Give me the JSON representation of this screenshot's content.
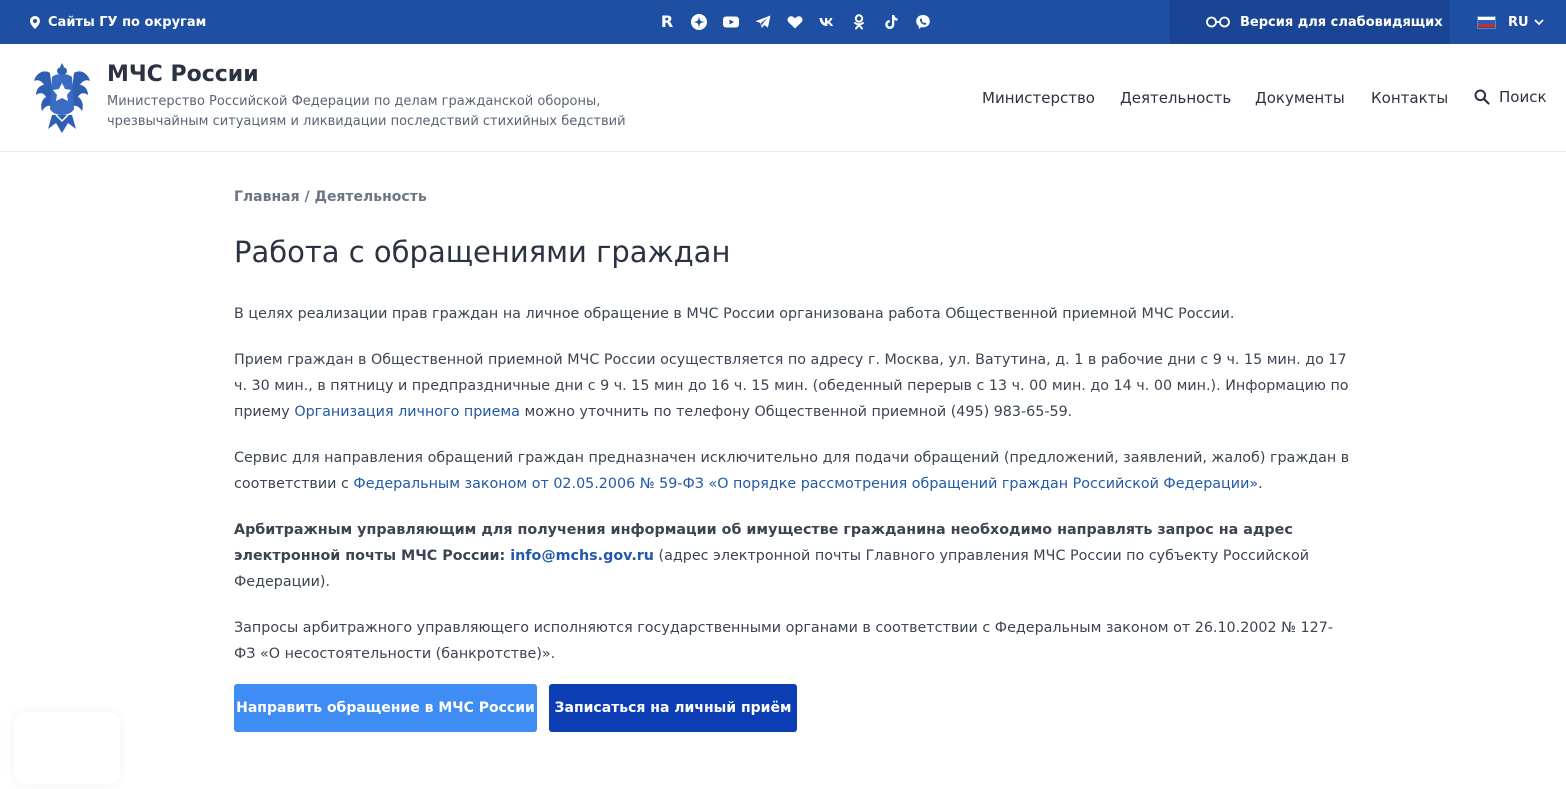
{
  "topbar": {
    "regions_label": "Сайты ГУ по округам",
    "social_icons": [
      "rutube-icon",
      "dzen-icon",
      "youtube-icon",
      "telegram-icon",
      "heart-icon",
      "vk-icon",
      "odnoklassniki-icon",
      "tiktok-icon",
      "viber-icon"
    ],
    "rutube_glyph": "R",
    "vision_label": "Версия для слабовидящих",
    "lang_label": "RU"
  },
  "header": {
    "title": "МЧС России",
    "subtitle": "Министерство Российской Федерации по делам гражданской обороны, чрезвычайным ситуациям и ликвидации последствий стихийных бедствий",
    "nav": [
      "Министерство",
      "Деятельность",
      "Документы",
      "Контакты"
    ],
    "search_label": "Поиск"
  },
  "breadcrumb": {
    "home": "Главная",
    "separator": " / ",
    "current": "Деятельность"
  },
  "page_title": "Работа с обращениями граждан",
  "paragraphs": {
    "p1": "В целях реализации прав граждан на личное обращение в МЧС России организована работа Общественной приемной МЧС России.",
    "p2_before": "Прием граждан в Общественной приемной МЧС России осуществляется по адресу г. Москва, ул. Ватутина, д. 1 в рабочие дни с 9 ч. 15 мин. до 17 ч. 30 мин., в пятницу и предпраздничные дни с 9 ч. 15 мин до 16 ч. 15 мин. (обеденный перерыв с 13 ч. 00 мин. до 14 ч. 00 мин.). Информацию по приему ",
    "p2_link": "Организация личного приема",
    "p2_after": " можно уточнить по телефону Общественной приемной (495) 983-65-59.",
    "p3_before": "Сервис для направления обращений граждан предназначен исключительно для подачи обращений (предложений, заявлений, жалоб) граждан в соответствии с ",
    "p3_link": "Федеральным законом от 02.05.2006 № 59-ФЗ «О порядке рассмотрения обращений граждан Российской Федерации»",
    "p3_after": ".",
    "p4_bold": "Арбитражным управляющим для получения информации об имуществе гражданина необходимо направлять запрос на адрес электронной почты МЧС России: ",
    "p4_email": "info@mchs.gov.ru",
    "p4_after": " (адрес электронной почты Главного управления МЧС России по субъекту Российской Федерации).",
    "p5": "Запросы арбитражного управляющего исполняются государственными органами в соответствии с Федеральным законом от 26.10.2002 № 127-ФЗ «О несостоятельности (банкротстве)»."
  },
  "buttons": {
    "send_appeal": "Направить обращение в МЧС России",
    "book_appointment": "Записаться на личный приём"
  },
  "colors": {
    "topbar": "#1e4fa3",
    "link": "#2359a8",
    "button_primary": "#3f8cf5",
    "button_secondary": "#0d3db5"
  }
}
